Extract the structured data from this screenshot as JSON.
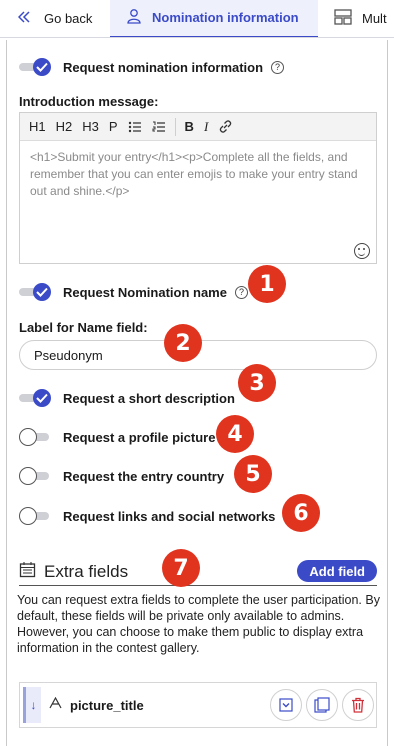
{
  "tabs": {
    "back_label": "Go back",
    "active_label": "Nomination information",
    "next_label": "Mult"
  },
  "settings": {
    "request_nomination_info": {
      "label": "Request nomination information",
      "on": true
    },
    "intro_label": "Introduction message:",
    "editor": {
      "toolbar": [
        "H1",
        "H2",
        "H3",
        "P"
      ],
      "body": "<h1>Submit your entry</h1><p>Complete all the fields, and remember that you can enter emojis to make your entry stand out and shine.</p>"
    },
    "request_name": {
      "label": "Request Nomination name",
      "on": true
    },
    "name_field_label": "Label for Name field:",
    "name_field_value": "Pseudonym",
    "request_short_description": {
      "label": "Request a short description",
      "on": true
    },
    "request_profile_picture": {
      "label": "Request a profile picture",
      "on": false
    },
    "request_entry_country": {
      "label": "Request the entry country",
      "on": false
    },
    "request_links": {
      "label": "Request links and social networks",
      "on": false
    }
  },
  "extra_fields": {
    "title": "Extra fields",
    "add_button": "Add field",
    "description": "You can request extra fields to complete the user participation. By default, these fields will be private only available to admins. However, you can choose to make them public to display extra information in the contest gallery.",
    "items": [
      {
        "name": "picture_title"
      }
    ]
  },
  "badges": [
    "1",
    "2",
    "3",
    "4",
    "5",
    "6",
    "7"
  ],
  "colors": {
    "accent": "#3b4bc8",
    "badge": "#e0341f",
    "delete": "#d0303a"
  }
}
